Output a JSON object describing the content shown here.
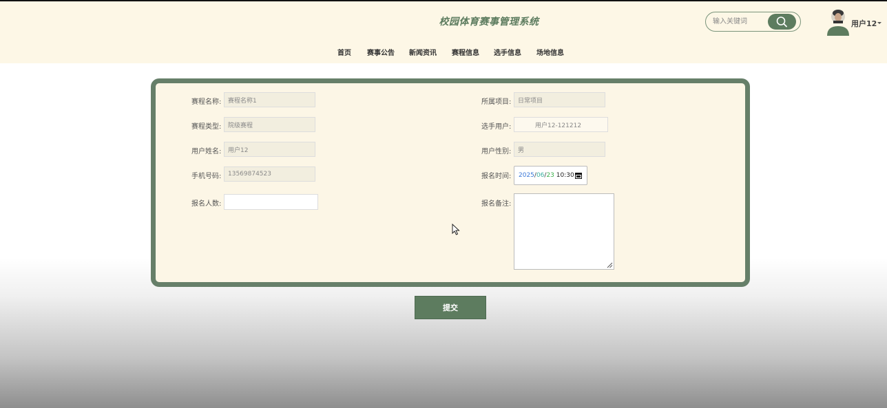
{
  "header": {
    "site_title": "校园体育赛事管理系统",
    "search_placeholder": "输入关键词",
    "user_name": "用户12"
  },
  "nav": [
    "首页",
    "赛事公告",
    "新闻资讯",
    "赛程信息",
    "选手信息",
    "场地信息"
  ],
  "form": {
    "schedule_name": {
      "label": "赛程名称:",
      "value": "赛程名称1"
    },
    "project": {
      "label": "所属项目:",
      "value": "日常项目"
    },
    "schedule_type": {
      "label": "赛程类型:",
      "value": "院级赛程"
    },
    "player_user": {
      "label": "选手用户:",
      "value": "用户12-121212"
    },
    "user_real_name": {
      "label": "用户姓名:",
      "value": "用户12"
    },
    "user_gender": {
      "label": "用户性别:",
      "value": "男"
    },
    "phone": {
      "label": "手机号码:",
      "value": "13569874523"
    },
    "signup_time": {
      "label": "报名时间:",
      "year": "2025",
      "month": "06",
      "day": "23",
      "time": "10:30"
    },
    "signup_count": {
      "label": "报名人数:",
      "value": ""
    },
    "signup_note": {
      "label": "报名备注:",
      "value": ""
    }
  },
  "submit_label": "提交",
  "colors": {
    "accent": "#5d7c5f",
    "header_bg": "#fdf7e6",
    "panel_border": "#667f69"
  },
  "icons": [
    "search-icon",
    "user-avatar",
    "calendar-icon",
    "resize-grip-icon",
    "mouse-cursor-icon"
  ]
}
